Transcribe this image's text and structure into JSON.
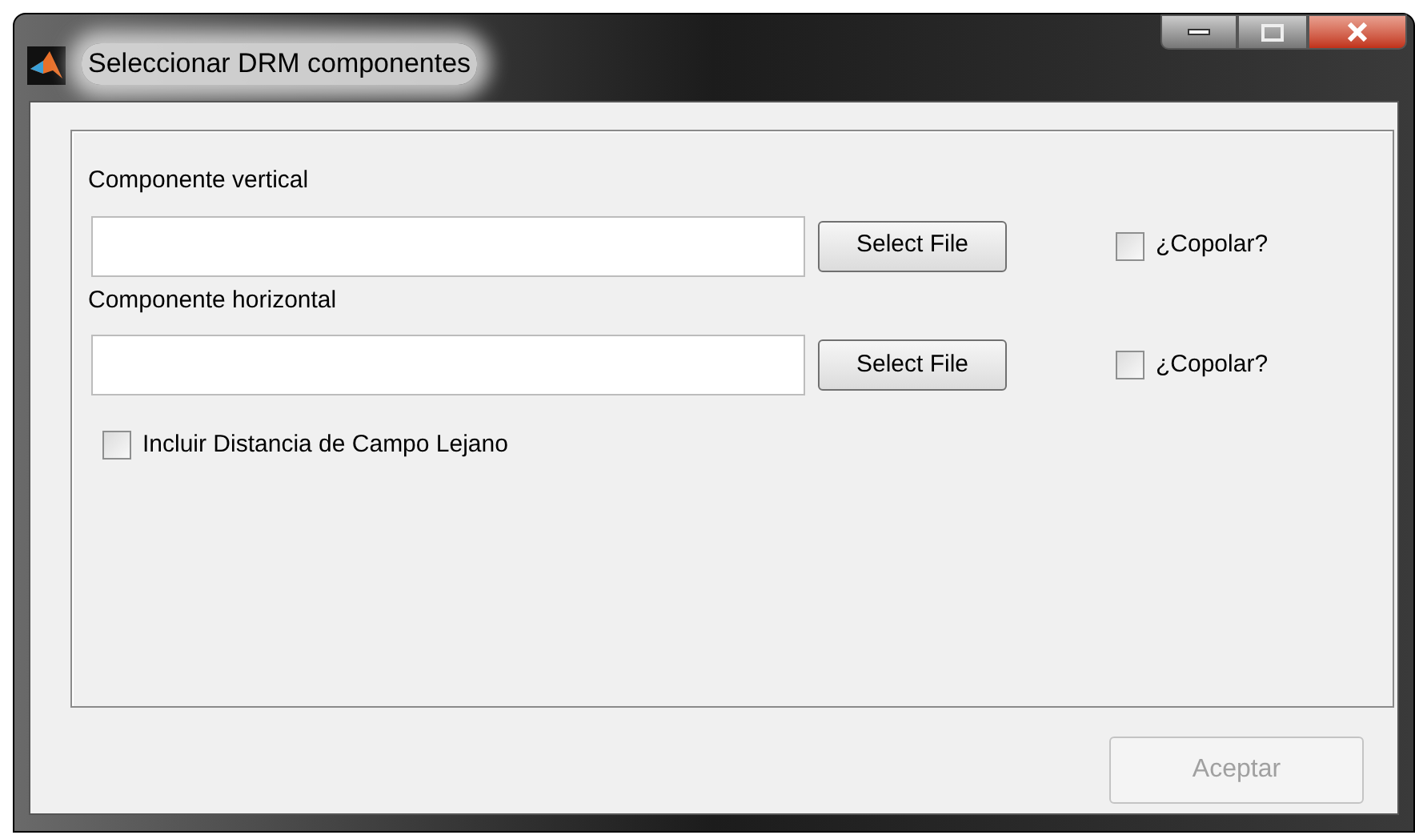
{
  "window": {
    "title": "Seleccionar DRM componentes"
  },
  "components": [
    {
      "label": "Componente vertical",
      "button": "Select File",
      "checkbox": {
        "label": "¿Copolar?",
        "checked": false
      }
    },
    {
      "label": "Componente horizontal",
      "button": "Select File",
      "checkbox": {
        "label": "¿Copolar?",
        "checked": false
      }
    }
  ],
  "far_field": {
    "label": "Incluir Distancia de Campo Lejano",
    "checked": false
  },
  "accept_button": {
    "label": "Aceptar",
    "disabled": true
  }
}
